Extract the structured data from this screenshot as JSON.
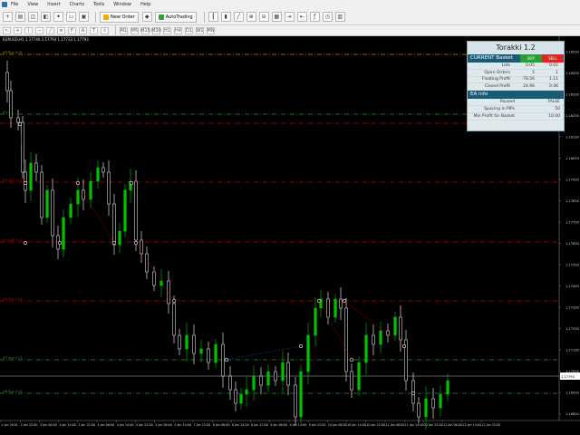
{
  "menu": {
    "items": [
      "File",
      "View",
      "Insert",
      "Charts",
      "Tools",
      "Window",
      "Help"
    ]
  },
  "toolbar": {
    "new_order_label": "New Order",
    "auto_trading_label": "AutoTrading",
    "timeframes": [
      "M1",
      "M5",
      "M15",
      "M30",
      "H1",
      "H4",
      "D1",
      "W1",
      "MN"
    ]
  },
  "chart": {
    "symbol_header": "EURUSD,H1  1.17740 1.17793 1.17733 1.17793",
    "current_price": "1.17793",
    "price_ticks": [
      "1.18530",
      "1.18430",
      "1.18330",
      "1.18230",
      "1.18130",
      "1.18030",
      "1.17930",
      "1.17830",
      "1.17730",
      "1.17630",
      "1.17530",
      "1.17430",
      "1.17330",
      "1.17230",
      "1.17130",
      "1.17030",
      "1.16930",
      "1.16830"
    ],
    "time_ticks": [
      "2 Jan 2018",
      "2 Jan 22:00",
      "3 Jan 06:00",
      "3 Jan 14:00",
      "3 Jan 22:00",
      "4 Jan 06:00",
      "4 Jan 14:00",
      "4 Jan 22:00",
      "5 Jan 06:00",
      "5 Jan 14:00",
      "7 Jan 22:00",
      "8 Jan 06:00",
      "8 Jan 14:00",
      "8 Jan 22:00",
      "9 Jan 06:00",
      "9 Jan 14:00",
      "9 Jan 22:00",
      "10 Jan 06:00",
      "10 Jan 14:00",
      "10 Jan 22:00",
      "11 Jan 06:00",
      "11 Jan 14:00",
      "11 Jan 22:00",
      "12 Jan 06:00",
      "12 Jan 14:00",
      "12 Jan 22:00"
    ],
    "level_labels": [
      "#5 Buy 0.01",
      "#1 Up",
      "#3 Buy 0.01",
      "#4 Buy 0.01",
      "#6 Buy 0.01",
      "#7 Buy 0.01",
      "#8 Buy 0.01"
    ],
    "colors": {
      "background": "#000000",
      "bull_candle": "#00c000",
      "bear_candle": "#ffffff",
      "buy_level": "#c00000",
      "target_level": "#3a8a3a",
      "top_level": "#c08000",
      "price_line": "#c0c0c0"
    }
  },
  "panel": {
    "title": "Torakki 1.2",
    "basket_header": "CURRENT Basket",
    "buy_label": "BUY",
    "sell_label": "SELL",
    "basket_rows": [
      {
        "label": "Lots",
        "buy": "0.05",
        "sell": "0.01"
      },
      {
        "label": "Open Orders",
        "buy": "5",
        "sell": "1"
      },
      {
        "label": "Floating Profit",
        "buy": "-78.56",
        "sell": "1.11"
      },
      {
        "label": "Closed Profit",
        "buy": "24.96",
        "sell": "0.46"
      }
    ],
    "ea_header": "EA info",
    "ea_rows": [
      {
        "label": "Paused",
        "value": "FALSE"
      },
      {
        "label": "Spacing in PIPs",
        "value": "50"
      },
      {
        "label": "Min Profit for Basket",
        "value": "10.00"
      }
    ]
  }
}
